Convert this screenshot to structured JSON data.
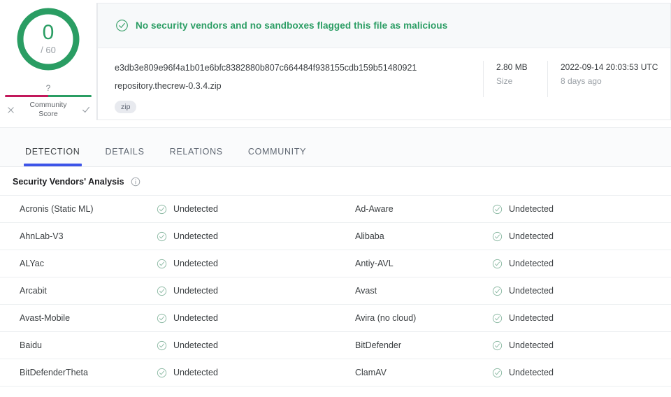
{
  "score": {
    "value": "0",
    "total": "/ 60",
    "ring_color": "#2a9d63"
  },
  "community_score": {
    "unknown_mark": "?",
    "label_line1": "Community",
    "label_line2": "Score",
    "negative_icon": "x-icon",
    "positive_icon": "check-icon",
    "negative_color": "#c2185b",
    "positive_color": "#2a9d63"
  },
  "verdict": {
    "icon": "check-circle-icon",
    "text": "No security vendors and no sandboxes flagged this file as malicious",
    "color": "#2a9d63"
  },
  "file": {
    "hash": "e3db3e809e96f4a1b01e6bfc8382880b807c664484f938155cdb159b51480921",
    "name": "repository.thecrew-0.3.4.zip",
    "tag": "zip",
    "size_value": "2.80 MB",
    "size_label": "Size",
    "date_value": "2022-09-14 20:03:53 UTC",
    "date_relative": "8 days ago"
  },
  "tabs": [
    {
      "label": "DETECTION",
      "active": true
    },
    {
      "label": "DETAILS",
      "active": false
    },
    {
      "label": "RELATIONS",
      "active": false
    },
    {
      "label": "COMMUNITY",
      "active": false
    }
  ],
  "analysis": {
    "title": "Security Vendors' Analysis",
    "info_icon": "info-icon",
    "status_icon": "check-circle-icon",
    "rows": [
      {
        "left_vendor": "Acronis (Static ML)",
        "left_status": "Undetected",
        "right_vendor": "Ad-Aware",
        "right_status": "Undetected"
      },
      {
        "left_vendor": "AhnLab-V3",
        "left_status": "Undetected",
        "right_vendor": "Alibaba",
        "right_status": "Undetected"
      },
      {
        "left_vendor": "ALYac",
        "left_status": "Undetected",
        "right_vendor": "Antiy-AVL",
        "right_status": "Undetected"
      },
      {
        "left_vendor": "Arcabit",
        "left_status": "Undetected",
        "right_vendor": "Avast",
        "right_status": "Undetected"
      },
      {
        "left_vendor": "Avast-Mobile",
        "left_status": "Undetected",
        "right_vendor": "Avira (no cloud)",
        "right_status": "Undetected"
      },
      {
        "left_vendor": "Baidu",
        "left_status": "Undetected",
        "right_vendor": "BitDefender",
        "right_status": "Undetected"
      },
      {
        "left_vendor": "BitDefenderTheta",
        "left_status": "Undetected",
        "right_vendor": "ClamAV",
        "right_status": "Undetected"
      }
    ]
  }
}
